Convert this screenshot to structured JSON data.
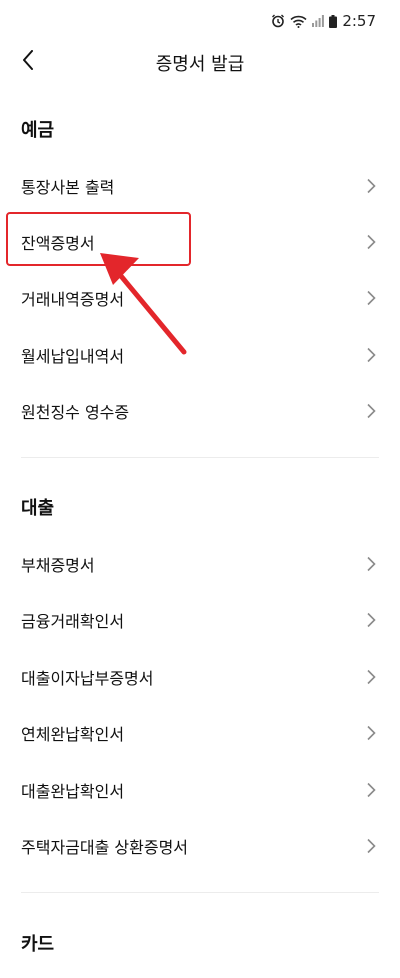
{
  "status_bar": {
    "time": "2:57"
  },
  "header": {
    "title": "증명서 발급"
  },
  "sections": [
    {
      "title": "예금",
      "items": [
        "통장사본 출력",
        "잔액증명서",
        "거래내역증명서",
        "월세납입내역서",
        "원천징수 영수증"
      ]
    },
    {
      "title": "대출",
      "items": [
        "부채증명서",
        "금융거래확인서",
        "대출이자납부증명서",
        "연체완납확인서",
        "대출완납확인서",
        "주택자금대출 상환증명서"
      ]
    },
    {
      "title": "카드",
      "items": []
    }
  ],
  "colors": {
    "annotation": "#e3262b",
    "text": "#111111",
    "chevron": "#8a8a8a",
    "divider": "#ececec"
  },
  "icons": [
    "alarm-icon",
    "wifi-icon",
    "signal-icon",
    "battery-icon",
    "back-arrow-icon",
    "chevron-right-icon"
  ]
}
